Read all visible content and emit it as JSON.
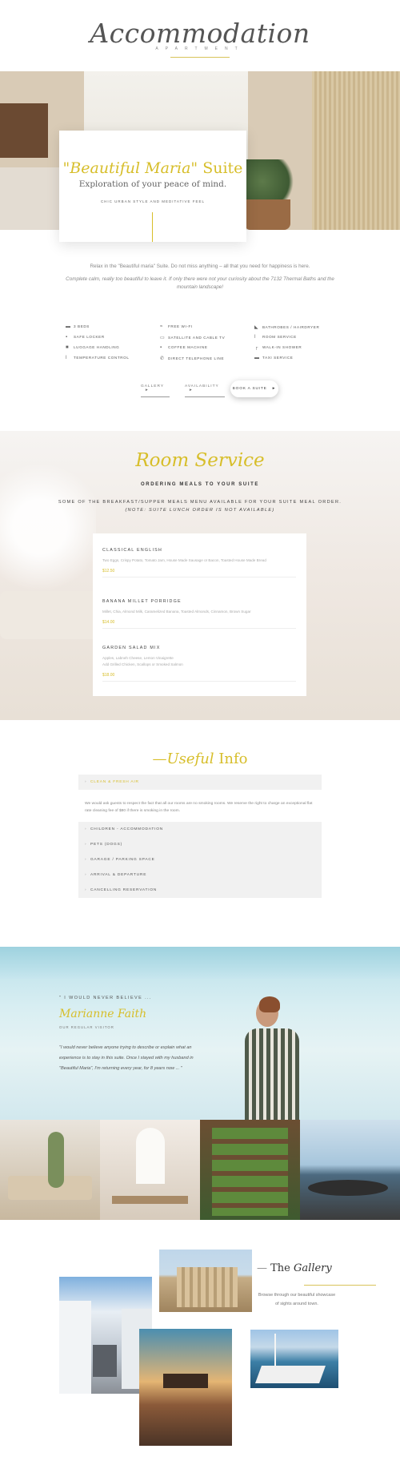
{
  "header": {
    "title": "Accommodation",
    "subtitle": "APARTMENT"
  },
  "hero": {
    "card": {
      "title_italic": "\"Beautiful Maria\"",
      "title_rest": "Suite",
      "subtitle": "Exploration of your peace of mind.",
      "tagline": "CHIC URBAN STYLE AND MEDITATIVE FEEL"
    }
  },
  "intro": {
    "line1": "Relax in the \"Beautiful maria\" Suite. Do not miss anything – all that you need for happiness is here.",
    "line2": "Complete calm, really too beautiful to leave it. If only there were not your curiosity about the 7132 Thermal Baths and the mountain landscape!"
  },
  "amenities": {
    "col1": [
      "3 BEDS",
      "SAFE LOCKER",
      "LUGGAGE HANDLING",
      "TEMPERATURE CONTROL"
    ],
    "col2": [
      "FREE WI-FI",
      "SATELLITE AND CABLE TV",
      "COFFEE MACHINE",
      "DIRECT TELEPHONE LINE"
    ],
    "col3": [
      "BATHROBES / HAIRDRYER",
      "ROOM SERVICE",
      "WALK-IN SHOWER",
      "TAXI SERVICE"
    ]
  },
  "actions": {
    "gallery": "GALLERY",
    "availability": "AVAILABILITY",
    "book": "BOOK A SUITE",
    "arrow": "►"
  },
  "room_service": {
    "title": "Room Service",
    "subtitle": "ORDERING MEALS TO YOUR SUITE",
    "desc": "SOME OF THE BREAKFAST/SUPPER MEALS MENU AVAILABLE FOR YOUR SUITE MEAL ORDER.",
    "note": "(NOTE: SUITE LUNCH ORDER IS NOT AVAILABLE)",
    "menu": [
      {
        "name": "CLASSICAL ENGLISH",
        "desc": "Two Eggs, Crispy Potato, Tomato Jam, House Made Sausage or Bacon, Toasted House Made Bread",
        "price": "$12.50"
      },
      {
        "name": "BANANA MILLET PORRIDGE",
        "desc": "Millet, Chia, Almond Milk, Caramelized Banana, Toasted Almonds, Cinnamon, Brown Sugar",
        "price": "$14.00"
      },
      {
        "name": "GARDEN SALAD MIX",
        "desc": "Apples, Labneh Cheese, Lemon Vinaigrette",
        "desc2": "Add Grilled Chicken, Scallops or Smoked Salmon",
        "price": "$18.00"
      }
    ]
  },
  "useful_info": {
    "title_italic": "Useful",
    "title_rest": "Info",
    "items": [
      {
        "label": "CLEAN & FRESH AIR",
        "open": true
      },
      {
        "label": "CHILDREN - ACCOMMODATION"
      },
      {
        "label": "PETS (DOGS)"
      },
      {
        "label": "GARAGE / PARKING SPACE"
      },
      {
        "label": "ARRIVAL & DEPARTURE"
      },
      {
        "label": "CANCELLING RESERVATION"
      }
    ],
    "open_body": "We would ask guests to respect the fact that all our rooms are no smoking rooms. We reserve the right to charge an exceptional flat rate cleaning fee of $80 if there is smoking in the room."
  },
  "testimonial": {
    "quote_head": "\" I WOULD NEVER BELIEVE ...",
    "name": "Marianne Faith",
    "role": "OUR REGULAR VISITOR",
    "text": "\"I would never believe anyone trying to describe or explain what an experience is to stay in this suite. Once I stayed with my husband in \"Beautiful Maria\", I'm returning every year, for 8 years now ... \""
  },
  "gallery": {
    "title_plain": "The",
    "title_italic": "Gallery",
    "desc": "Browse through our beautiful showcase of sights around town."
  },
  "colors": {
    "accent": "#d7be2a",
    "text": "#555555",
    "panel": "#f1f1f1"
  }
}
